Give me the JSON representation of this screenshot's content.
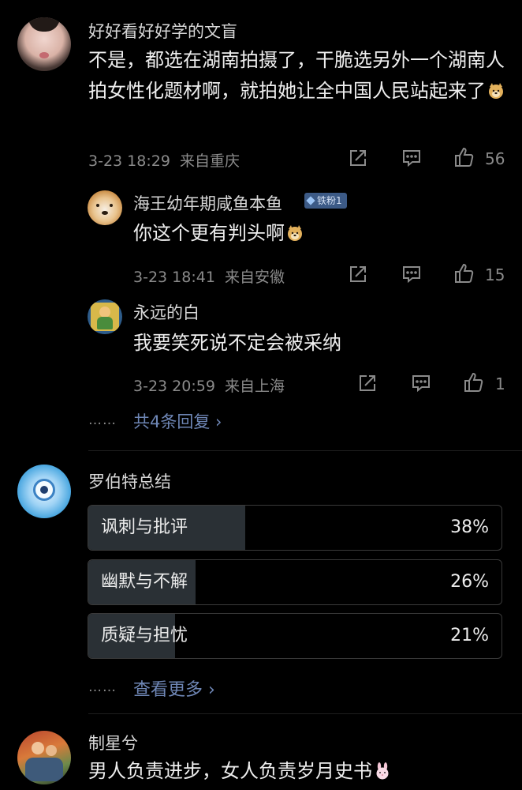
{
  "comments": [
    {
      "username": "好好看好好学的文盲",
      "text": "不是，都选在湖南拍摄了，干脆选另外一个湖南人拍女性化题材啊，就拍她让全中国人民站起来了",
      "emoji": "doge-emoji",
      "time": "3-23 18:29",
      "location": "来自重庆",
      "likes": "56"
    }
  ],
  "replies": [
    {
      "username": "海王幼年期咸鱼本鱼",
      "badge": "铁粉1",
      "text": "你这个更有判头啊",
      "emoji": "doge-emoji",
      "time": "3-23 18:41",
      "location": "来自安徽",
      "likes": "15"
    },
    {
      "username": "永远的白",
      "text": "我要笑死说不定会被采纳",
      "time": "3-23 20:59",
      "location": "来自上海",
      "likes": "1"
    }
  ],
  "more_replies": {
    "dots": "……",
    "label": "共4条回复 ›"
  },
  "poll": {
    "username": "罗伯特总结",
    "options": [
      {
        "label": "讽刺与批评",
        "percent": "38%",
        "value": 38
      },
      {
        "label": "幽默与不解",
        "percent": "26%",
        "value": 26
      },
      {
        "label": "质疑与担忧",
        "percent": "21%",
        "value": 21
      }
    ],
    "more_dots": "……",
    "more_label": "查看更多 ›"
  },
  "last_comment": {
    "username": "制星兮",
    "text": "男人负责进步，女人负责岁月史书",
    "emoji": "rabbit-emoji"
  },
  "colors": {
    "link": "#6e86b5",
    "meta": "#8a8a8a",
    "badge": "#3c5a86",
    "poll_fill": "#2a3035"
  }
}
